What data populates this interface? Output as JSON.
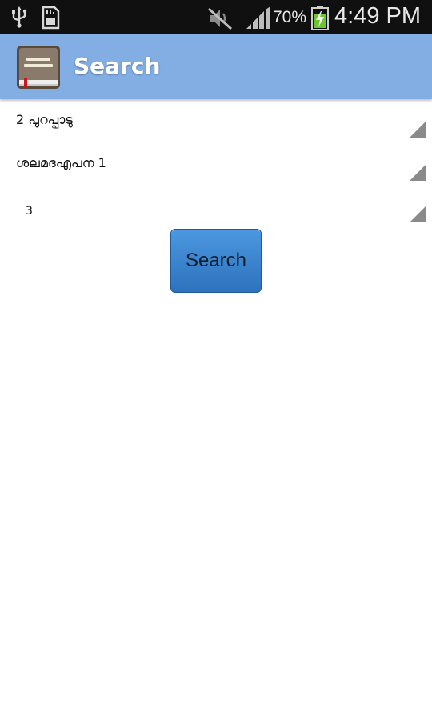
{
  "status_bar": {
    "battery_percent": "70%",
    "time": "4:49 PM",
    "icons": [
      "usb-icon",
      "sd-card-icon",
      "mute-icon",
      "signal-icon",
      "battery-charging-icon"
    ]
  },
  "action_bar": {
    "title": "Search",
    "app_icon": "book-icon"
  },
  "form": {
    "book_spinner": {
      "selected": "2  പുറപ്പാടു"
    },
    "chapter_spinner": {
      "selected": "ശലമദഎപന  1"
    },
    "verse_spinner": {
      "selected": "3"
    },
    "search_label": "Search"
  },
  "colors": {
    "status_bar_bg": "#101010",
    "action_bar_bg": "#82aee3",
    "button_bg": "#3a84d0",
    "page_bg": "#ffffff"
  }
}
